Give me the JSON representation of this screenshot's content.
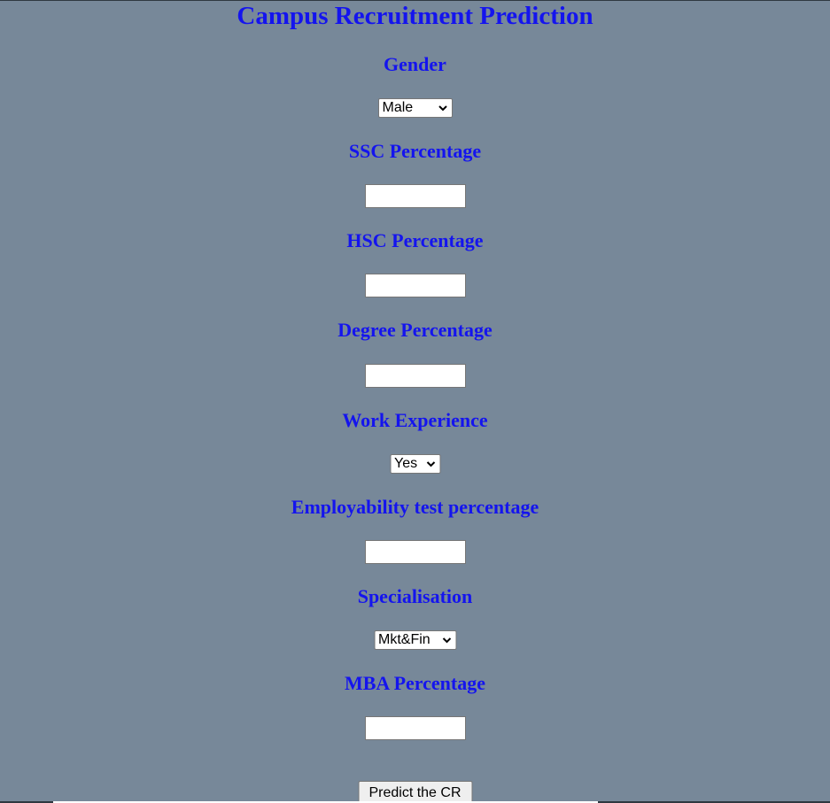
{
  "page": {
    "title": "Campus Recruitment Prediction"
  },
  "form": {
    "gender": {
      "label": "Gender",
      "selected": "Male"
    },
    "ssc": {
      "label": "SSC Percentage",
      "value": ""
    },
    "hsc": {
      "label": "HSC Percentage",
      "value": ""
    },
    "degree": {
      "label": "Degree Percentage",
      "value": ""
    },
    "work_experience": {
      "label": "Work Experience",
      "selected": "Yes"
    },
    "employability": {
      "label": "Employability test percentage",
      "value": ""
    },
    "specialisation": {
      "label": "Specialisation",
      "selected": "Mkt&Fin"
    },
    "mba": {
      "label": "MBA Percentage",
      "value": ""
    },
    "submit_label": "Predict the CR"
  },
  "icons": {
    "select_chevron": "chevron-down-icon"
  },
  "colors": {
    "background": "#778899",
    "heading": "#1414ee"
  }
}
